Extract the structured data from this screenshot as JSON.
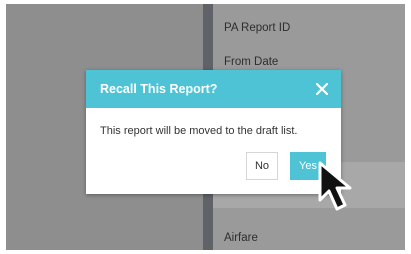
{
  "background_form": {
    "labels": [
      "PA Report ID",
      "From Date",
      "Airfare"
    ]
  },
  "dialog": {
    "title": "Recall This Report?",
    "message": "This report will be moved to the draft list.",
    "no_label": "No",
    "yes_label": "Yes",
    "close_icon": "close-icon",
    "accent_color": "#4ec3d6"
  },
  "pointer": {
    "icon": "mouse-pointer-icon"
  }
}
